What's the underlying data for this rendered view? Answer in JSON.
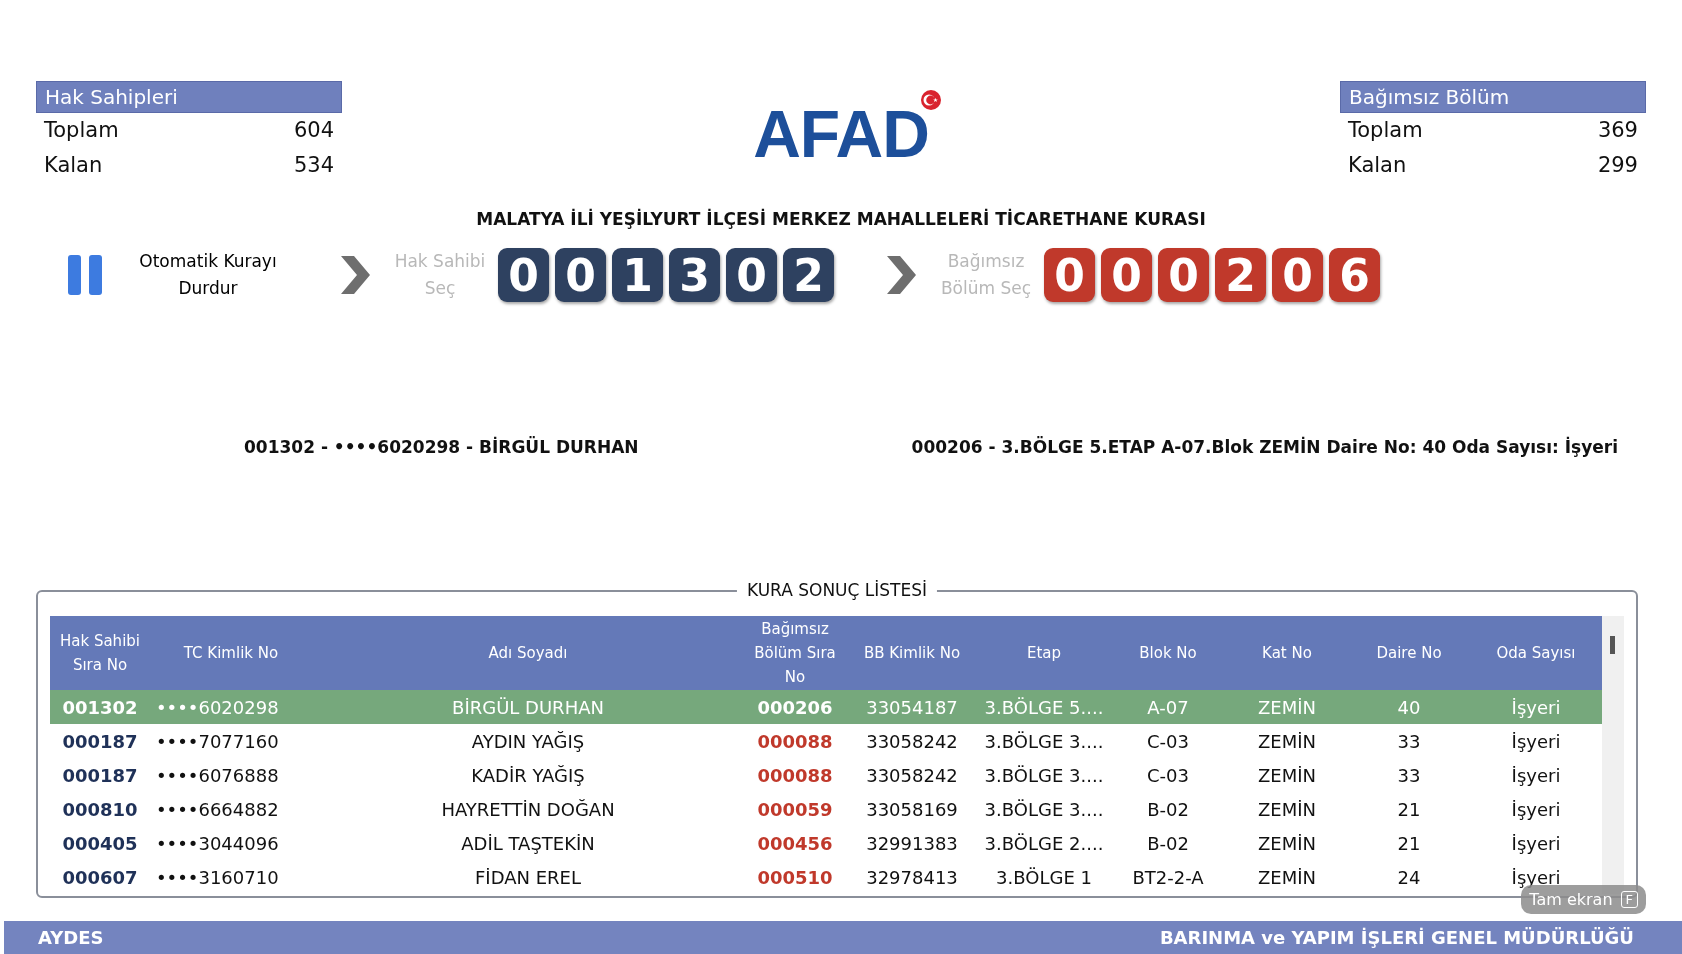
{
  "left_panel": {
    "title": "Hak Sahipleri",
    "rows": [
      {
        "label": "Toplam",
        "value": "604"
      },
      {
        "label": "Kalan",
        "value": "534"
      }
    ]
  },
  "logo": {
    "text": "AFAD"
  },
  "right_panel": {
    "title": "Bağımsız Bölüm",
    "rows": [
      {
        "label": "Toplam",
        "value": "369"
      },
      {
        "label": "Kalan",
        "value": "299"
      }
    ]
  },
  "heading": "MALATYA İLİ YEŞİLYURT İLÇESİ MERKEZ MAHALLELERİ TİCARETHANE KURASI",
  "pause_button": {
    "label": "Otomatik Kurayı Durdur"
  },
  "counters": [
    {
      "label": "Hak Sahibi Seç",
      "digits": [
        "0",
        "0",
        "1",
        "3",
        "0",
        "2"
      ],
      "color": "#2e4160"
    },
    {
      "label": "Bağımsız Bölüm Seç",
      "digits": [
        "0",
        "0",
        "0",
        "2",
        "0",
        "6"
      ],
      "color": "#c0392b"
    }
  ],
  "result_left": "001302 - ••••6020298 - BİRGÜL DURHAN",
  "result_right": "000206 - 3.BÖLGE 5.ETAP A-07.Blok ZEMİN Daire No: 40 Oda Sayısı: İşyeri",
  "results": {
    "title": "KURA SONUÇ LİSTESİ",
    "columns": [
      "Hak Sahibi Sıra No",
      "TC Kimlik No",
      "Adı Soyadı",
      "Bağımsız Bölüm Sıra No",
      "BB Kimlik No",
      "Etap",
      "Blok No",
      "Kat No",
      "Daire No",
      "Oda Sayısı"
    ],
    "rows": [
      {
        "selected": true,
        "cells": [
          "001302",
          "••••6020298",
          "BİRGÜL DURHAN",
          "000206",
          "33054187",
          "3.BÖLGE 5....",
          "A-07",
          "ZEMİN",
          "40",
          "İşyeri"
        ]
      },
      {
        "selected": false,
        "cells": [
          "000187",
          "••••7077160",
          "AYDIN YAĞIŞ",
          "000088",
          "33058242",
          "3.BÖLGE 3....",
          "C-03",
          "ZEMİN",
          "33",
          "İşyeri"
        ]
      },
      {
        "selected": false,
        "cells": [
          "000187",
          "••••6076888",
          "KADİR YAĞIŞ",
          "000088",
          "33058242",
          "3.BÖLGE 3....",
          "C-03",
          "ZEMİN",
          "33",
          "İşyeri"
        ]
      },
      {
        "selected": false,
        "cells": [
          "000810",
          "••••6664882",
          "HAYRETTİN DOĞAN",
          "000059",
          "33058169",
          "3.BÖLGE 3....",
          "B-02",
          "ZEMİN",
          "21",
          "İşyeri"
        ]
      },
      {
        "selected": false,
        "cells": [
          "000405",
          "••••3044096",
          "ADİL TAŞTEKİN",
          "000456",
          "32991383",
          "3.BÖLGE 2....",
          "B-02",
          "ZEMİN",
          "21",
          "İşyeri"
        ]
      },
      {
        "selected": false,
        "cells": [
          "000607",
          "••••3160710",
          "FİDAN EREL",
          "000510",
          "32978413",
          "3.BÖLGE 1",
          "BT2-2-A",
          "ZEMİN",
          "24",
          "İşyeri"
        ]
      }
    ]
  },
  "fullscreen_hint": {
    "label": "Tam ekran",
    "key": "F"
  },
  "footer": {
    "left": "AYDES",
    "right": "BARINMA ve YAPIM İŞLERİ GENEL MÜDÜRLÜĞÜ"
  }
}
